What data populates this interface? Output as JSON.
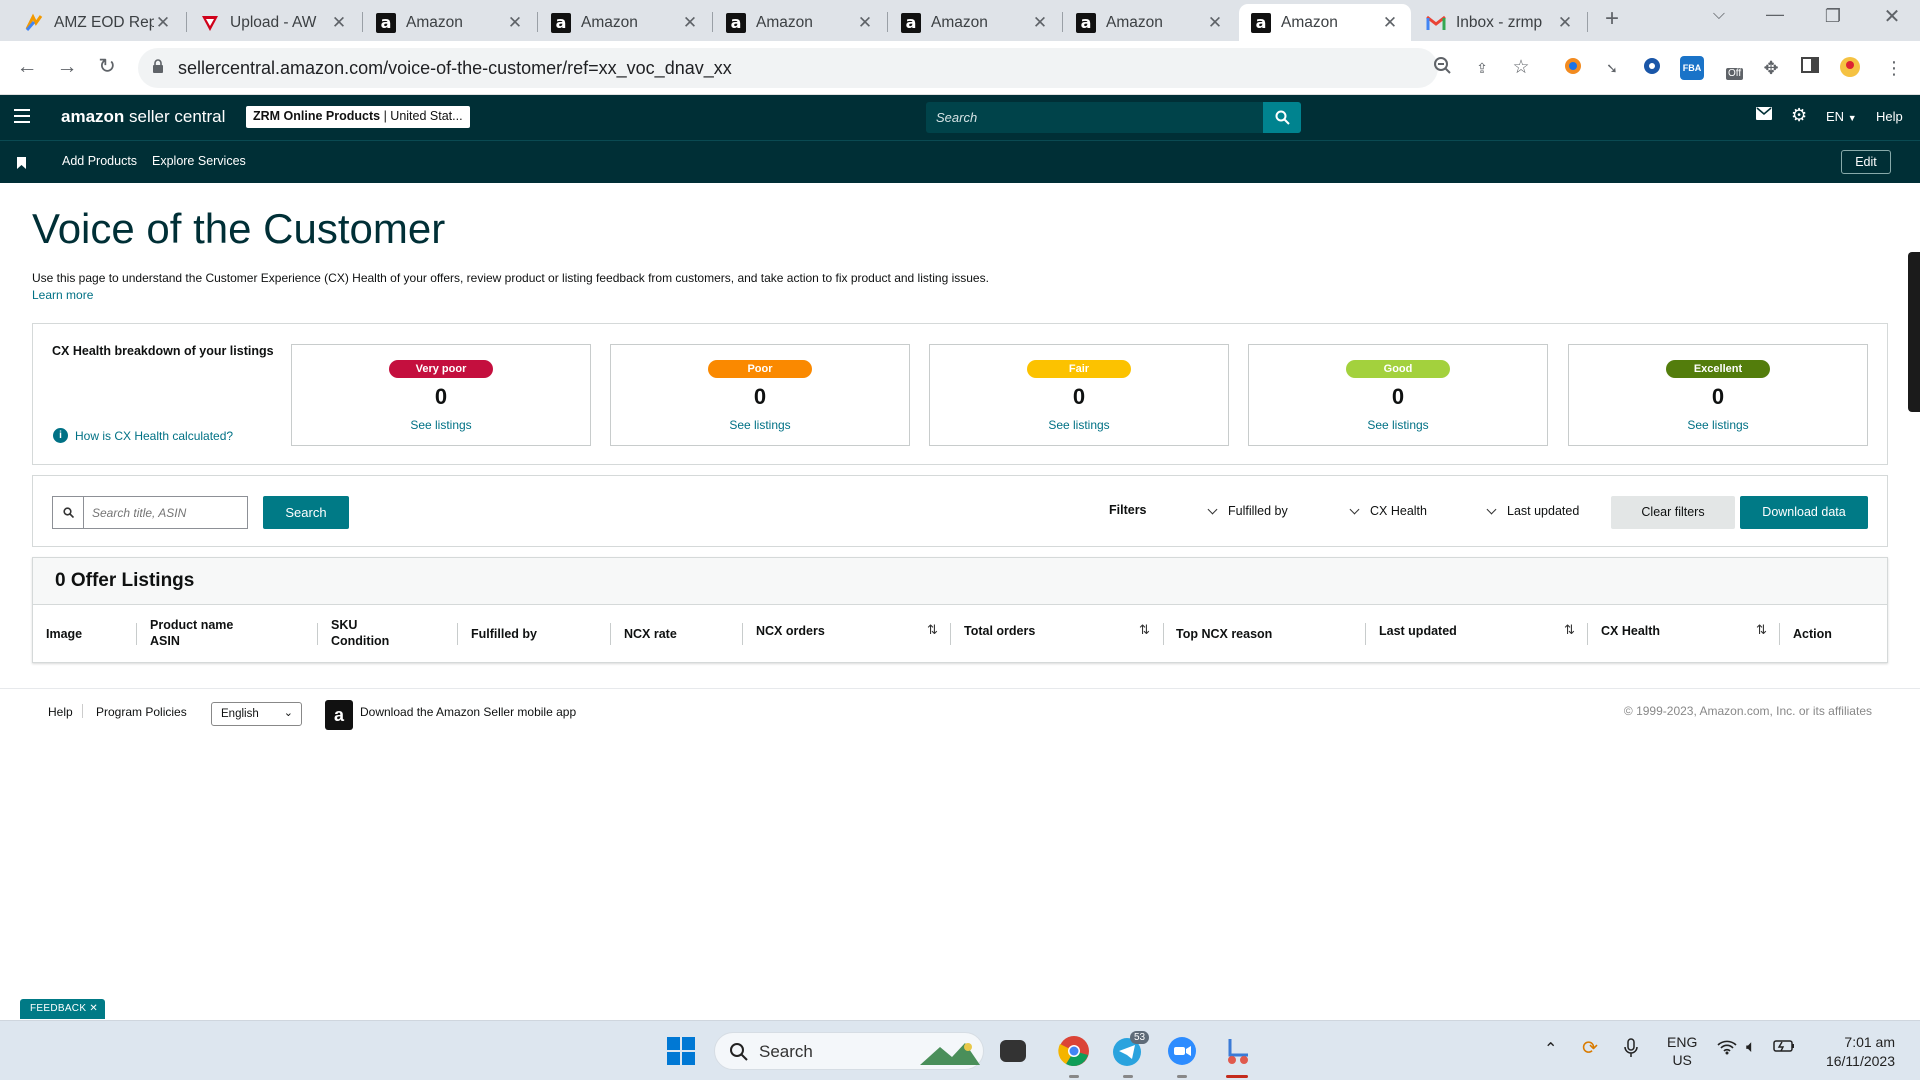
{
  "browser": {
    "tabs": [
      {
        "title": "AMZ EOD Rep",
        "icon": "chart-favicon"
      },
      {
        "title": "Upload - AW",
        "icon": "red-v-favicon"
      },
      {
        "title": "Amazon",
        "icon": "amazon-favicon"
      },
      {
        "title": "Amazon",
        "icon": "amazon-favicon"
      },
      {
        "title": "Amazon",
        "icon": "amazon-favicon"
      },
      {
        "title": "Amazon",
        "icon": "amazon-favicon"
      },
      {
        "title": "Amazon",
        "icon": "amazon-favicon"
      },
      {
        "title": "Amazon",
        "icon": "amazon-favicon",
        "active": true
      },
      {
        "title": "Inbox - zrmp",
        "icon": "gmail-favicon"
      }
    ],
    "url": "sellercentral.amazon.com/voice-of-the-customer/ref=xx_voc_dnav_xx",
    "ext_badge": "Off"
  },
  "header": {
    "logo_bold": "amazon",
    "logo_rest": " seller central",
    "store_bold": "ZRM Online Products",
    "store_rest": " | United Stat...",
    "search_placeholder": "Search",
    "language": "EN",
    "help": "Help"
  },
  "nav": {
    "add_products": "Add Products",
    "explore_services": "Explore Services",
    "edit": "Edit"
  },
  "page": {
    "title": "Voice of the Customer",
    "description": "Use this page to understand the Customer Experience (CX) Health of your offers, review product or listing feedback from customers, and take action to fix product and listing issues.",
    "learn_more": "Learn more"
  },
  "cx": {
    "heading": "CX Health breakdown of your listings",
    "how_link": "How is CX Health calculated?",
    "buckets": [
      {
        "label": "Very poor",
        "count": "0",
        "link": "See listings",
        "color": "#c40f3e"
      },
      {
        "label": "Poor",
        "count": "0",
        "link": "See listings",
        "color": "#fa8900"
      },
      {
        "label": "Fair",
        "count": "0",
        "link": "See listings",
        "color": "#fcc200"
      },
      {
        "label": "Good",
        "count": "0",
        "link": "See listings",
        "color": "#a3d13d"
      },
      {
        "label": "Excellent",
        "count": "0",
        "link": "See listings",
        "color": "#537d0c"
      }
    ]
  },
  "filters": {
    "search_placeholder": "Search title, ASIN",
    "search_button": "Search",
    "label": "Filters",
    "fulfilled_by": "Fulfilled by",
    "cx_health": "CX Health",
    "last_updated": "Last updated",
    "clear": "Clear filters",
    "download": "Download data"
  },
  "listings": {
    "title": "0 Offer Listings",
    "columns": {
      "image": "Image",
      "product_name": "Product name",
      "asin": "ASIN",
      "sku": "SKU",
      "condition": "Condition",
      "fulfilled_by": "Fulfilled by",
      "ncx_rate": "NCX rate",
      "ncx_orders": "NCX orders",
      "total_orders": "Total orders",
      "top_ncx_reason": "Top NCX reason",
      "last_updated": "Last updated",
      "cx_health": "CX Health",
      "action": "Action"
    }
  },
  "footer": {
    "help": "Help",
    "program_policies": "Program Policies",
    "language": "English",
    "app_text": "Download the Amazon Seller mobile app",
    "copyright": "© 1999-2023, Amazon.com, Inc. or its affiliates",
    "feedback": "FEEDBACK"
  },
  "taskbar": {
    "search": "Search",
    "telegram_badge": "53",
    "lang_line1": "ENG",
    "lang_line2": "US",
    "time": "7:01 am",
    "date": "16/11/2023"
  }
}
